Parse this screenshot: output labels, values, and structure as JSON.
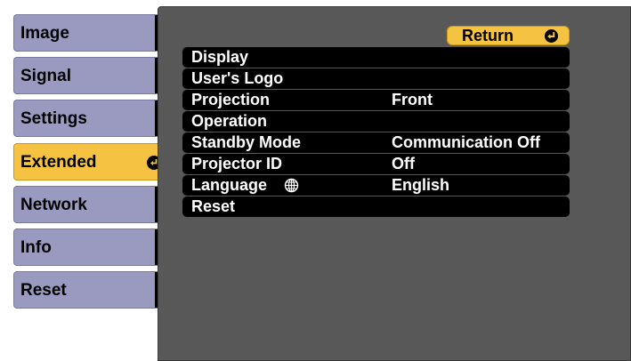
{
  "tabs": [
    {
      "label": "Image",
      "active": false
    },
    {
      "label": "Signal",
      "active": false
    },
    {
      "label": "Settings",
      "active": false
    },
    {
      "label": "Extended",
      "active": true
    },
    {
      "label": "Network",
      "active": false
    },
    {
      "label": "Info",
      "active": false
    },
    {
      "label": "Reset",
      "active": false
    }
  ],
  "return_button": {
    "label": "Return",
    "icon": "enter-icon"
  },
  "menu": [
    {
      "label": "Display",
      "value": ""
    },
    {
      "label": "User's Logo",
      "value": ""
    },
    {
      "label": "Projection",
      "value": "Front"
    },
    {
      "label": "Operation",
      "value": ""
    },
    {
      "label": "Standby Mode",
      "value": "Communication Off"
    },
    {
      "label": "Projector ID",
      "value": "Off"
    },
    {
      "label": "Language",
      "value": "English",
      "icon": "globe-icon"
    },
    {
      "label": "Reset",
      "value": ""
    }
  ],
  "colors": {
    "accent": "#f5c242",
    "tab": "#9a9ac0",
    "panel": "#585858"
  }
}
